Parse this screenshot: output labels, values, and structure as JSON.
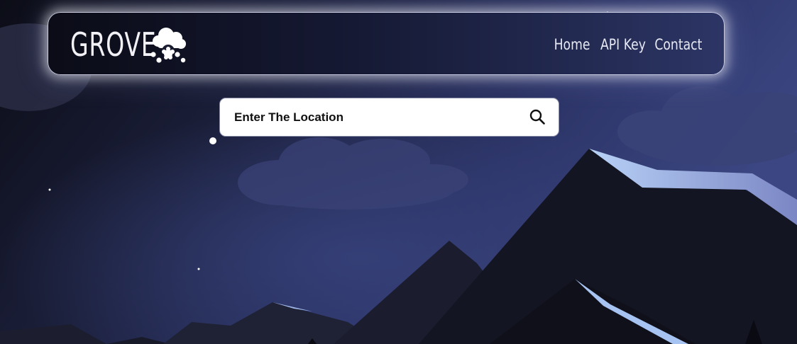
{
  "brand": {
    "name": "GROVE",
    "icon": "snow-cloud-icon"
  },
  "nav": {
    "items": [
      {
        "label": "Home"
      },
      {
        "label": "API Key"
      },
      {
        "label": "Contact"
      }
    ]
  },
  "search": {
    "placeholder": "Enter The Location",
    "value": "",
    "icon": "search-icon"
  },
  "colors": {
    "sky_dark": "#0d0e18",
    "sky_mid": "#2e3768",
    "mountain_dark": "#121320",
    "snow": "#a8c4f2",
    "nav_text": "#e6e8f3",
    "search_bg": "#ffffff"
  }
}
